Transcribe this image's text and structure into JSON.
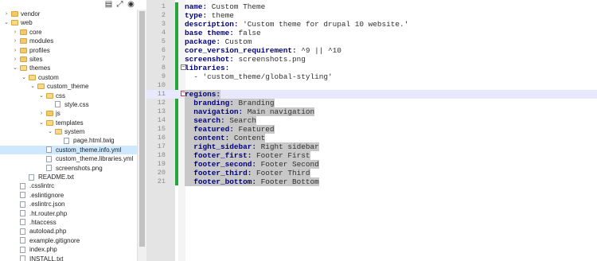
{
  "toolbar": {
    "icons": [
      "collapse-all-icon",
      "expand-icon",
      "locate-icon"
    ]
  },
  "tree": [
    {
      "label": "vendor",
      "type": "folder",
      "depth": 0,
      "expanded": false
    },
    {
      "label": "web",
      "type": "folder",
      "depth": 0,
      "expanded": true
    },
    {
      "label": "core",
      "type": "folder",
      "depth": 1,
      "expanded": false
    },
    {
      "label": "modules",
      "type": "folder",
      "depth": 1,
      "expanded": false
    },
    {
      "label": "profiles",
      "type": "folder",
      "depth": 1,
      "expanded": false
    },
    {
      "label": "sites",
      "type": "folder",
      "depth": 1,
      "expanded": false
    },
    {
      "label": "themes",
      "type": "folder",
      "depth": 1,
      "expanded": true
    },
    {
      "label": "custom",
      "type": "folder",
      "depth": 2,
      "expanded": true
    },
    {
      "label": "custom_theme",
      "type": "folder",
      "depth": 3,
      "expanded": true
    },
    {
      "label": "css",
      "type": "folder",
      "depth": 4,
      "expanded": true
    },
    {
      "label": "style.css",
      "type": "file",
      "depth": 5
    },
    {
      "label": "js",
      "type": "folder",
      "depth": 4,
      "expanded": false
    },
    {
      "label": "templates",
      "type": "folder",
      "depth": 4,
      "expanded": true
    },
    {
      "label": "system",
      "type": "folder",
      "depth": 5,
      "expanded": true
    },
    {
      "label": "page.html.twig",
      "type": "file",
      "depth": 6
    },
    {
      "label": "custom_theme.info.yml",
      "type": "file",
      "depth": 4,
      "selected": true
    },
    {
      "label": "custom_theme.libraries.yml",
      "type": "file",
      "depth": 4
    },
    {
      "label": "screenshots.png",
      "type": "file",
      "depth": 4
    },
    {
      "label": "README.txt",
      "type": "file",
      "depth": 2
    },
    {
      "label": ".csslintrc",
      "type": "file",
      "depth": 1
    },
    {
      "label": ".eslintignore",
      "type": "file",
      "depth": 1
    },
    {
      "label": ".eslintrc.json",
      "type": "file",
      "depth": 1
    },
    {
      "label": ".ht.router.php",
      "type": "file",
      "depth": 1
    },
    {
      "label": ".htaccess",
      "type": "file",
      "depth": 1
    },
    {
      "label": "autoload.php",
      "type": "file",
      "depth": 1
    },
    {
      "label": "example.gitignore",
      "type": "file",
      "depth": 1
    },
    {
      "label": "index.php",
      "type": "file",
      "depth": 1
    },
    {
      "label": "INSTALL.txt",
      "type": "file",
      "depth": 1
    }
  ],
  "editor": {
    "lines": [
      {
        "n": "1",
        "key": "name:",
        "val": " Custom Theme"
      },
      {
        "n": "2",
        "key": "type:",
        "val": " theme"
      },
      {
        "n": "3",
        "key": "description:",
        "val": " 'Custom theme for drupal 10 website.'"
      },
      {
        "n": "4",
        "key": "base theme:",
        "val": " false"
      },
      {
        "n": "5",
        "key": "package:",
        "val": " Custom"
      },
      {
        "n": "6",
        "key": "core_version_requirement:",
        "val": " ^9 || ^10"
      },
      {
        "n": "7",
        "key": "screenshot:",
        "val": " screenshots.png"
      },
      {
        "n": "8",
        "key": "libraries:",
        "val": "",
        "fold": "box"
      },
      {
        "n": "9",
        "key": "",
        "val": "  - 'custom_theme/global-styling'"
      },
      {
        "n": "10",
        "key": "",
        "val": ""
      },
      {
        "n": "11",
        "key": "regions:",
        "val": "",
        "fold": "boxred",
        "current": true,
        "hl": true
      },
      {
        "n": "12",
        "key": "  branding:",
        "val": " Branding",
        "hl": true
      },
      {
        "n": "13",
        "key": "  navigation:",
        "val": " Main navigation",
        "hl": true
      },
      {
        "n": "14",
        "key": "  search:",
        "val": " Search",
        "hl": true
      },
      {
        "n": "15",
        "key": "  featured:",
        "val": " Featured",
        "hl": true
      },
      {
        "n": "16",
        "key": "  content:",
        "val": " Content",
        "hl": true
      },
      {
        "n": "17",
        "key": "  right_sidebar:",
        "val": " Right sidebar",
        "hl": true
      },
      {
        "n": "18",
        "key": "  footer_first:",
        "val": " Footer First",
        "hl": true
      },
      {
        "n": "19",
        "key": "  footer_second:",
        "val": " Footer Second",
        "hl": true
      },
      {
        "n": "20",
        "key": "  footer_third:",
        "val": " Footer Third",
        "hl": true
      },
      {
        "n": "21",
        "key": "  footer_bottom:",
        "val": " Footer Bottom",
        "hl": true
      }
    ]
  }
}
